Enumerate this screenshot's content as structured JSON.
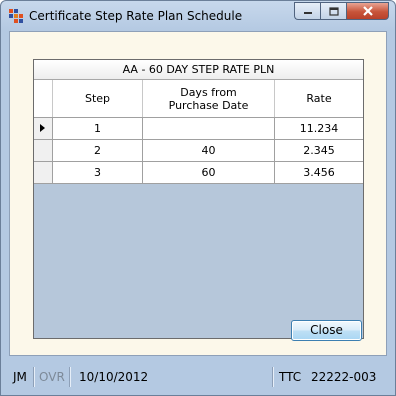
{
  "window": {
    "title": "Certificate Step Rate Plan Schedule"
  },
  "grid": {
    "caption": "AA - 60 DAY STEP RATE PLN",
    "columns": [
      "Step",
      "Days from\nPurchase Date",
      "Rate"
    ],
    "rows": [
      {
        "step": "1",
        "days": "",
        "rate": "11.234",
        "current": true
      },
      {
        "step": "2",
        "days": "40",
        "rate": "2.345",
        "current": false
      },
      {
        "step": "3",
        "days": "60",
        "rate": "3.456",
        "current": false
      }
    ]
  },
  "buttons": {
    "close_label": "Close"
  },
  "statusbar": {
    "user": "JM",
    "mode": "OVR",
    "date": "10/10/2012",
    "terminal": "TTC",
    "account": "22222-003"
  },
  "colors": {
    "titlebar": "#b4c9e2",
    "client_background": "#fcf8ea",
    "grid_empty_area": "#b6c7da",
    "close_caption_button": "#c8543a"
  }
}
